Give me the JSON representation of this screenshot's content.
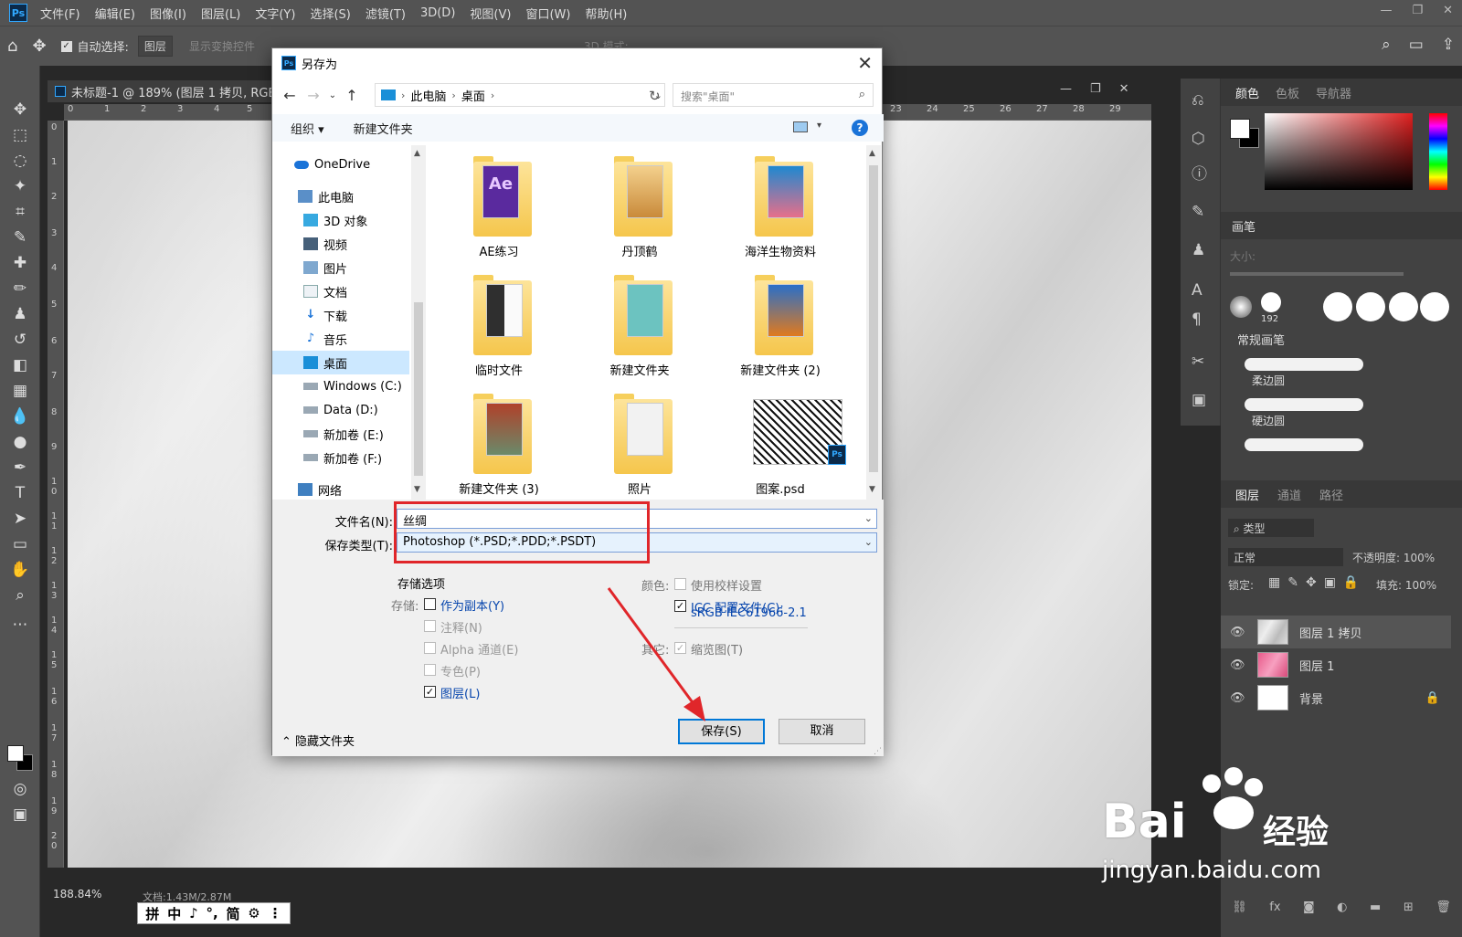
{
  "menubar": {
    "app_icon": "Ps",
    "items": [
      "文件(F)",
      "编辑(E)",
      "图像(I)",
      "图层(L)",
      "文字(Y)",
      "选择(S)",
      "滤镜(T)",
      "3D(D)",
      "视图(V)",
      "窗口(W)",
      "帮助(H)"
    ]
  },
  "optbar": {
    "auto_select_label": "自动选择:",
    "auto_select_checked": true,
    "auto_select_target": "图层",
    "show_transform_label": "显示变换控件",
    "mode_3d_label": "3D 模式:"
  },
  "document": {
    "tab_title": "未标题-1 @ 189% (图层 1 拷贝, RGB",
    "zoom_readout": "188.84%",
    "doc_size": "文档:1.43M/2.87M",
    "ruler_top_labels": [
      "0",
      "1",
      "2",
      "3",
      "4",
      "5",
      "23",
      "24",
      "25",
      "26",
      "27",
      "28",
      "29"
    ],
    "ruler_left_labels": [
      "0",
      "1",
      "2",
      "3",
      "4",
      "5",
      "6",
      "7",
      "8",
      "9",
      "1 0",
      "1 1",
      "1 2",
      "1 3",
      "1 4",
      "1 5",
      "1 6",
      "1 7",
      "1 8",
      "1 9",
      "2 0"
    ]
  },
  "ime_bar": {
    "items": [
      "拼",
      "中",
      "♪",
      "°,",
      "简",
      "⚙",
      "⋮"
    ]
  },
  "panels": {
    "color_tabs": [
      "颜色",
      "色板",
      "导航器"
    ],
    "brush_title": "画笔",
    "brush_size_label": "大小:",
    "brush_tip_size": "192",
    "brush_group": "常规画笔",
    "brush_soft": "柔边圆",
    "brush_hard": "硬边圆",
    "layer_tabs": [
      "图层",
      "通道",
      "路径"
    ],
    "layer_filter": "类型",
    "blend_mode": "正常",
    "opacity_label": "不透明度:",
    "opacity_value": "100%",
    "lock_label": "锁定:",
    "fill_label": "填充:",
    "fill_value": "100%",
    "layers": [
      {
        "name": "图层 1 拷贝",
        "selected": true
      },
      {
        "name": "图层 1",
        "selected": false
      },
      {
        "name": "背景",
        "selected": false
      }
    ]
  },
  "dialog": {
    "title": "另存为",
    "breadcrumb": [
      "此电脑",
      "桌面"
    ],
    "search_placeholder": "搜索\"桌面\"",
    "cmd_organize": "组织 ▾",
    "cmd_new_folder": "新建文件夹",
    "help": "?",
    "nav_items": [
      {
        "label": "OneDrive",
        "icon": "cloud-icon"
      },
      {
        "label": "此电脑",
        "icon": "computer-icon"
      },
      {
        "label": "3D 对象",
        "icon": "cube-icon"
      },
      {
        "label": "视频",
        "icon": "video-icon"
      },
      {
        "label": "图片",
        "icon": "picture-icon"
      },
      {
        "label": "文档",
        "icon": "document-icon"
      },
      {
        "label": "下载",
        "icon": "download-icon"
      },
      {
        "label": "音乐",
        "icon": "music-icon"
      },
      {
        "label": "桌面",
        "icon": "desktop-icon",
        "active": true
      },
      {
        "label": "Windows (C:)",
        "icon": "drive-icon"
      },
      {
        "label": "Data (D:)",
        "icon": "drive-icon"
      },
      {
        "label": "新加卷 (E:)",
        "icon": "drive-icon"
      },
      {
        "label": "新加卷 (F:)",
        "icon": "drive-icon"
      },
      {
        "label": "网络",
        "icon": "network-icon"
      }
    ],
    "files": [
      {
        "label": "AE练习",
        "kind": "folder",
        "accent": "#5a2a9e"
      },
      {
        "label": "丹顶鹤",
        "kind": "folder",
        "accent": "#c98a3a"
      },
      {
        "label": "海洋生物资料",
        "kind": "folder",
        "accent": "#1e88d0"
      },
      {
        "label": "临时文件",
        "kind": "folder",
        "accent": "#2f2f2f"
      },
      {
        "label": "新建文件夹",
        "kind": "folder",
        "accent": "#6cc3c0"
      },
      {
        "label": "新建文件夹 (2)",
        "kind": "folder",
        "accent": "#e07a1e"
      },
      {
        "label": "新建文件夹 (3)",
        "kind": "folder",
        "accent": "#b0412a"
      },
      {
        "label": "照片",
        "kind": "folder",
        "accent": "#dcdcdc"
      },
      {
        "label": "图案.psd",
        "kind": "psd",
        "accent": "#111111"
      }
    ],
    "filename_label": "文件名(N):",
    "filename_value": "丝绸",
    "savetype_label": "保存类型(T):",
    "savetype_value": "Photoshop (*.PSD;*.PDD;*.PSDT)",
    "options_title": "存储选项",
    "store_label": "存储:",
    "as_copy": "作为副本(Y)",
    "notes": "注释(N)",
    "alpha": "Alpha 通道(E)",
    "spot": "专色(P)",
    "layers": "图层(L)",
    "color_label": "颜色:",
    "use_proof": "使用校样设置",
    "icc_line1": "ICC 配置文件(C):",
    "icc_line2": "sRGB IEC61966-2.1",
    "other_label": "其它:",
    "thumbnail": "缩览图(T)",
    "hide_folders": "隐藏文件夹",
    "save_button": "保存(S)",
    "cancel_button": "取消"
  },
  "watermark": {
    "brand": "Bai",
    "brand_suffix": "经验",
    "url": "jingyan.baidu.com"
  },
  "colors": {
    "highlight_red": "#e0262a",
    "ps_blue": "#31a8ff"
  }
}
